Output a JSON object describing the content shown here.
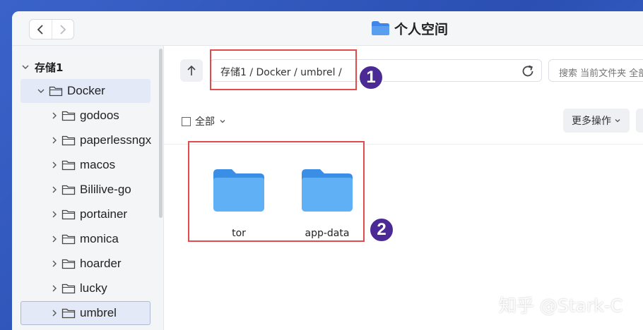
{
  "window": {
    "title": "个人空间",
    "title_icon": "folder-icon"
  },
  "sidebar": {
    "root": {
      "label": "存储1",
      "expanded": true
    },
    "items": [
      {
        "label": "Docker",
        "expanded": true,
        "selected": true
      },
      {
        "label": "godoos"
      },
      {
        "label": "paperlessngx"
      },
      {
        "label": "macos"
      },
      {
        "label": "Bililive-go"
      },
      {
        "label": "portainer"
      },
      {
        "label": "monica"
      },
      {
        "label": "hoarder"
      },
      {
        "label": "lucky"
      },
      {
        "label": "umbrel",
        "active": true
      }
    ]
  },
  "toolbar": {
    "path": "存储1 / Docker / umbrel /",
    "search_placeholder": "搜索 当前文件夹 全部",
    "select_all_label": "全部",
    "more_actions_label": "更多操作"
  },
  "files": [
    {
      "name": "tor",
      "type": "folder"
    },
    {
      "name": "app-data",
      "type": "folder"
    }
  ],
  "annotations": [
    {
      "label": "1"
    },
    {
      "label": "2"
    }
  ],
  "watermark": "知乎 @Stark-C",
  "colors": {
    "folder": "#4ea2f2",
    "annotation_box": "#e34a4a",
    "badge": "#4b2a96",
    "selection": "#e4e9f7"
  }
}
